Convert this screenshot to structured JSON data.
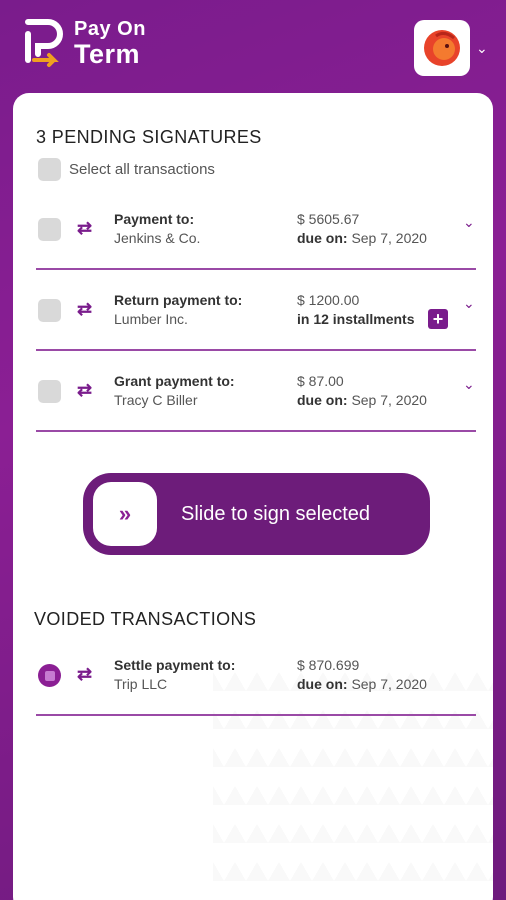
{
  "app": {
    "logo_line1": "Pay On",
    "logo_line2": "Term"
  },
  "pending": {
    "title": "3 PENDING SIGNATURES",
    "select_all": "Select all transactions",
    "rows": [
      {
        "label": "Payment to:",
        "payee": "Jenkins & Co.",
        "amount": "$ 5605.67",
        "due_label": "due on:",
        "due_value": "Sep 7, 2020"
      },
      {
        "label": "Return payment to:",
        "payee": "Lumber Inc.",
        "amount": "$ 1200.00",
        "installments": "in 12 installments"
      },
      {
        "label": "Grant payment to:",
        "payee": "Tracy C Biller",
        "amount": "$ 87.00",
        "due_label": "due on:",
        "due_value": "Sep 7, 2020"
      }
    ]
  },
  "slider": {
    "label": "Slide to sign selected",
    "icon": "double-chevron-right-icon"
  },
  "voided": {
    "title": "VOIDED TRANSACTIONS",
    "rows": [
      {
        "label": "Settle payment to:",
        "payee": "Trip LLC",
        "amount": "$ 870.699",
        "due_label": "due on:",
        "due_value": "Sep 7, 2020"
      }
    ]
  },
  "colors": {
    "brand": "#7a1c8c",
    "divider": "#9a4aa6",
    "accent": "#f05a28"
  }
}
